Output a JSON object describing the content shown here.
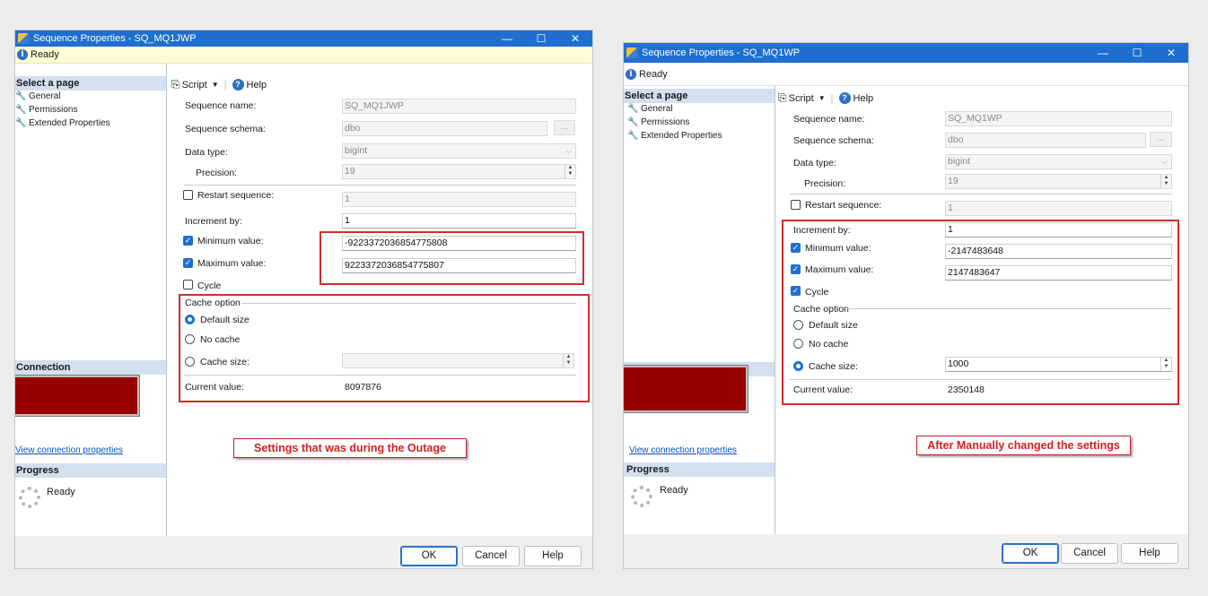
{
  "left": {
    "title": "Sequence Properties - SQ_MQ1JWP",
    "controls": {
      "minimize": "—",
      "maximize": "☐",
      "close": "✕"
    },
    "status": "Ready",
    "select_page": "Select a page",
    "nav": [
      "General",
      "Permissions",
      "Extended Properties"
    ],
    "connection": "Connection",
    "view_connection": "View connection properties",
    "progress": "Progress",
    "progress_status": "Ready",
    "toolbar": {
      "script": "Script",
      "help": "Help"
    },
    "labels": {
      "sequence_name": "Sequence name:",
      "sequence_schema": "Sequence schema:",
      "data_type": "Data type:",
      "precision": "Precision:",
      "restart": "Restart sequence:",
      "increment": "Increment by:",
      "minimum": "Minimum value:",
      "maximum": "Maximum value:",
      "cycle": "Cycle",
      "cache_option": "Cache option",
      "default_size": "Default size",
      "no_cache": "No cache",
      "cache_size": "Cache size:",
      "current_value": "Current value:"
    },
    "values": {
      "sequence_name": "SQ_MQ1JWP",
      "sequence_schema": "dbo",
      "schema_button": "...",
      "data_type": "bigint",
      "precision": "19",
      "restart": "1",
      "increment": "1",
      "minimum": "-9223372036854775808",
      "maximum": "9223372036854775807",
      "cache_size": "",
      "current_value": "8097876"
    },
    "annotation": "Settings that was during the Outage",
    "buttons": {
      "ok": "OK",
      "cancel": "Cancel",
      "help": "Help"
    }
  },
  "right": {
    "title": "Sequence Properties - SQ_MQ1WP",
    "controls": {
      "minimize": "—",
      "maximize": "☐",
      "close": "✕"
    },
    "status": "Ready",
    "select_page": "Select a page",
    "nav": [
      "General",
      "Permissions",
      "Extended Properties"
    ],
    "view_connection": "View connection properties",
    "progress": "Progress",
    "progress_status": "Ready",
    "toolbar": {
      "script": "Script",
      "help": "Help"
    },
    "labels": {
      "sequence_name": "Sequence name:",
      "sequence_schema": "Sequence schema:",
      "data_type": "Data type:",
      "precision": "Precision:",
      "restart": "Restart sequence:",
      "increment": "Increment by:",
      "minimum": "Minimum value:",
      "maximum": "Maximum value:",
      "cycle": "Cycle",
      "cache_option": "Cache option",
      "default_size": "Default size",
      "no_cache": "No cache",
      "cache_size": "Cache size:",
      "current_value": "Current value:"
    },
    "values": {
      "sequence_name": "SQ_MQ1WP",
      "sequence_schema": "dbo",
      "schema_button": "...",
      "data_type": "bigint",
      "precision": "19",
      "restart": "1",
      "increment": "1",
      "minimum": "-2147483648",
      "maximum": "2147483647",
      "cache_size": "1000",
      "current_value": "2350148"
    },
    "annotation": "After Manually changed the settings",
    "buttons": {
      "ok": "OK",
      "cancel": "Cancel",
      "help": "Help"
    }
  }
}
